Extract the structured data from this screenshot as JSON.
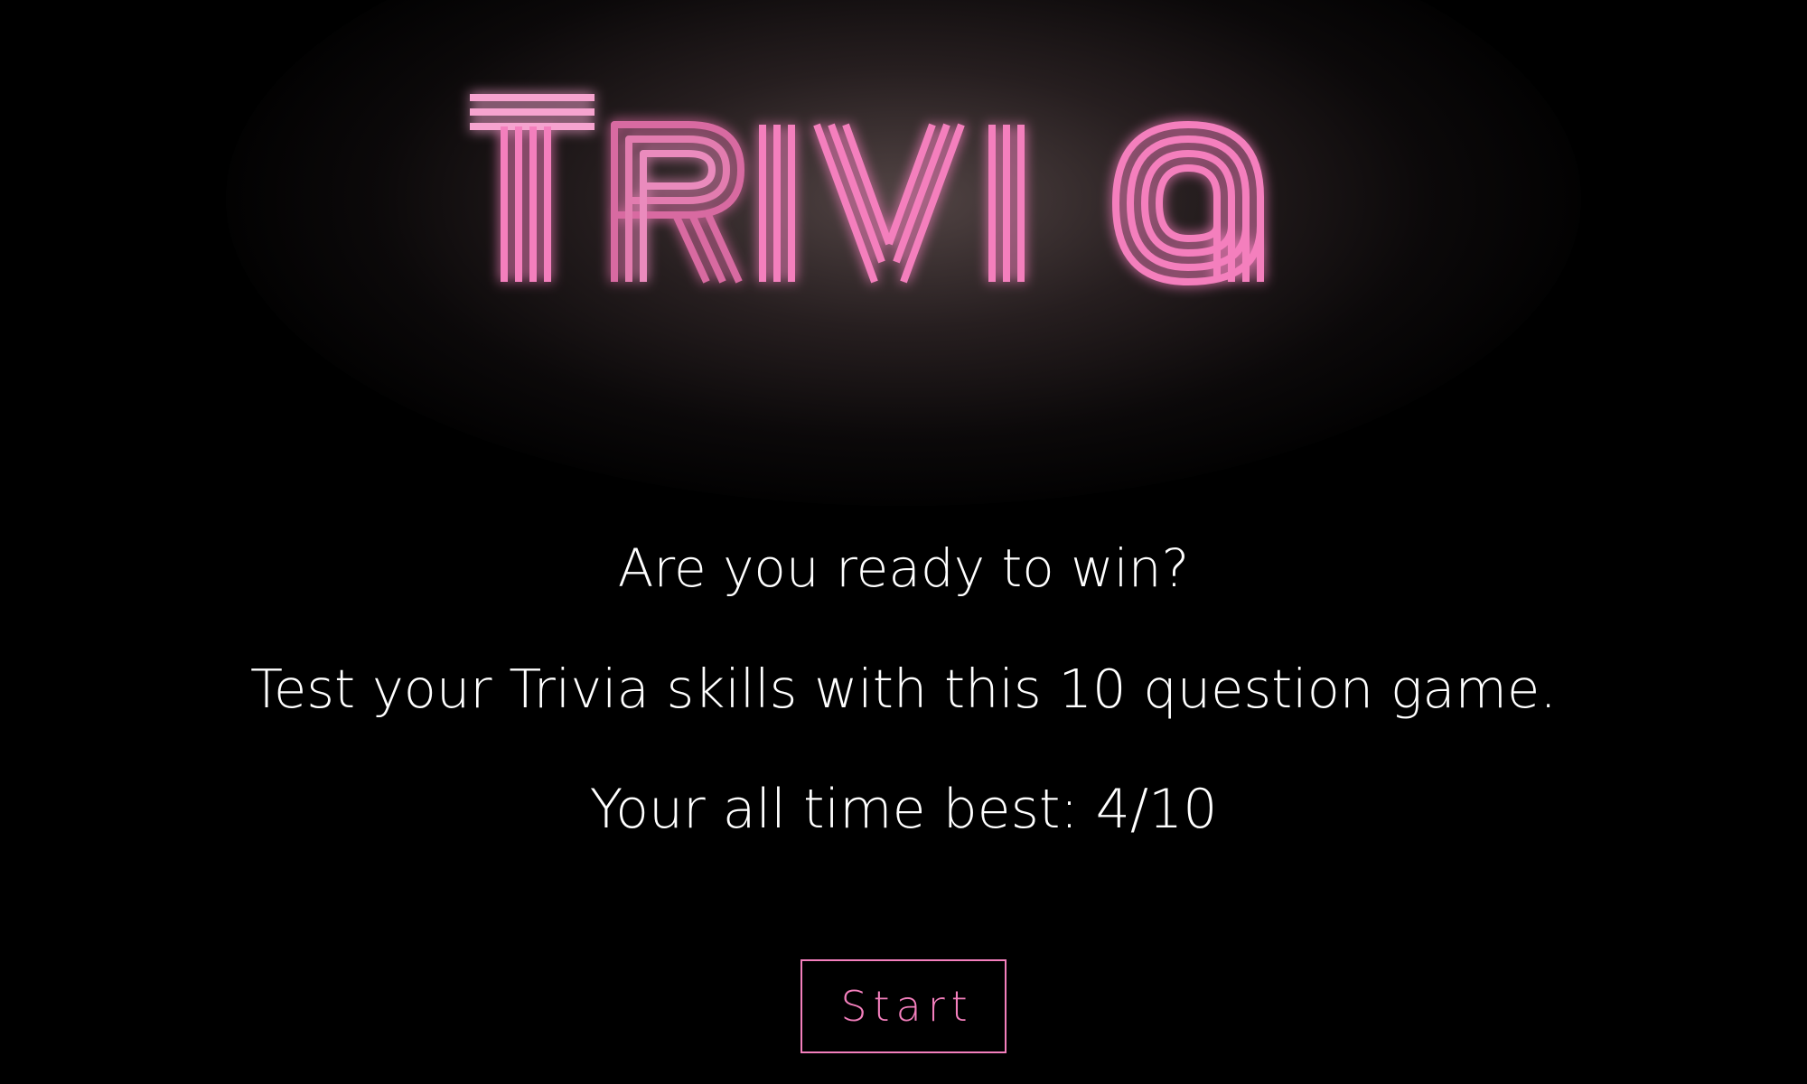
{
  "app": {
    "title": "Trivia",
    "colors": {
      "background": "#000000",
      "accent": "#f47fbd",
      "text": "#ffffff",
      "glow": "#a08080"
    }
  },
  "intro": {
    "ready_text": "Are you ready to win?",
    "description": "Test your Trivia skills with this 10 question game.",
    "best_label": "Your all time best: 4/10"
  },
  "actions": {
    "start_label": "Start"
  }
}
